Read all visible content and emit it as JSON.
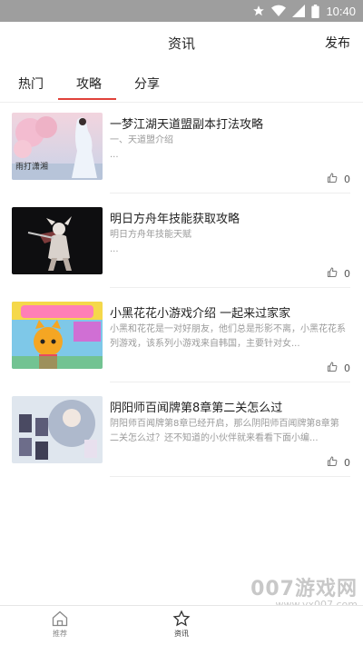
{
  "status_bar": {
    "time": "10:40"
  },
  "header": {
    "title": "资讯",
    "publish_label": "发布"
  },
  "tabs": [
    {
      "label": "热门",
      "active": false
    },
    {
      "label": "攻略",
      "active": true
    },
    {
      "label": "分享",
      "active": false
    }
  ],
  "colors": {
    "accent": "#e0423a",
    "status_bar": "#9e9e9e"
  },
  "articles": [
    {
      "title": "一梦江湖天道盟副本打法攻略",
      "summary": "一、天道盟介绍\n...",
      "likes": "0"
    },
    {
      "title": "明日方舟年技能获取攻略",
      "summary": "明日方舟年技能天赋\n...",
      "likes": "0"
    },
    {
      "title": "小黑花花小游戏介绍 一起来过家家",
      "summary": "小黑和花花是一对好朋友，他们总是形影不离，小黑花花系列游戏，该系列小游戏来自韩国，主要针对女...",
      "likes": "0"
    },
    {
      "title": "阴阳师百闻牌第8章第二关怎么过",
      "summary": "阴阳师百闻牌第8章已经开启，那么阴阳师百闻牌第8章第二关怎么过？还不知道的小伙伴就来看看下面小编...",
      "likes": "0"
    }
  ],
  "bottom_nav": [
    {
      "label": "推荐",
      "icon": "home-icon",
      "active": false
    },
    {
      "label": "资讯",
      "icon": "star-icon",
      "active": true
    }
  ],
  "watermark": {
    "line1": "007游戏网",
    "line2": "www.yx007.com"
  }
}
